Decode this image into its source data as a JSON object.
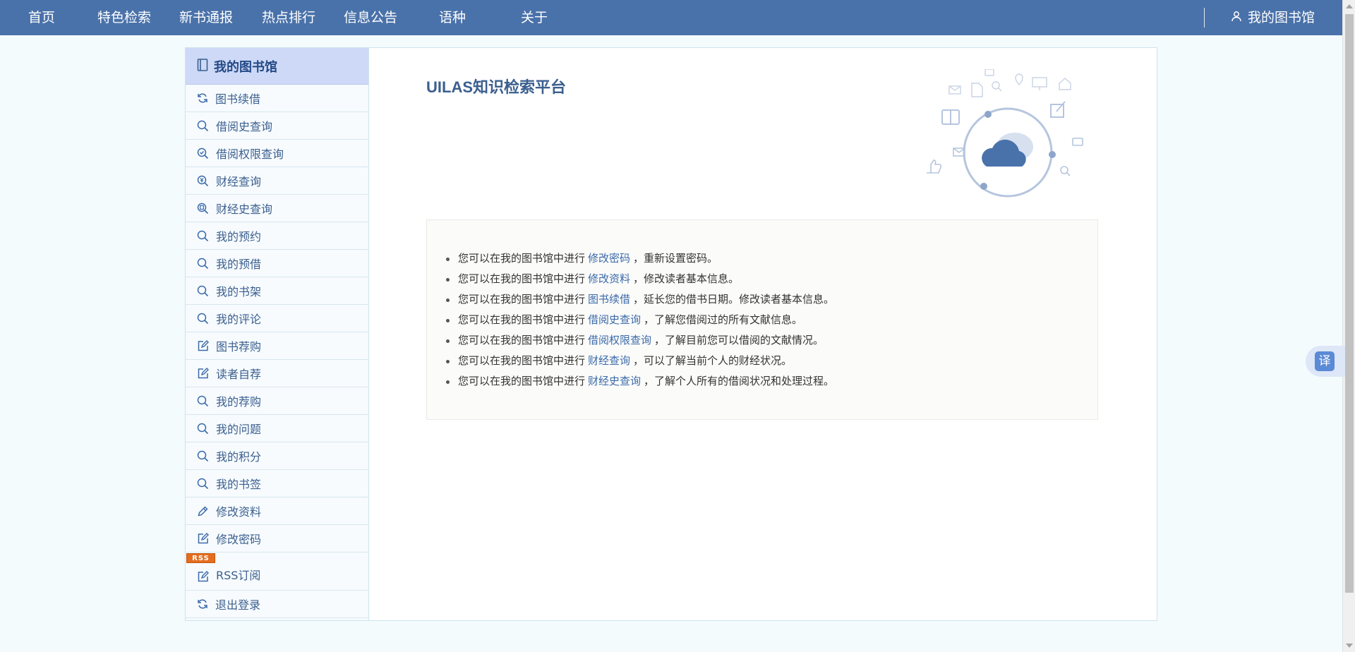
{
  "nav": {
    "items": [
      {
        "label": "首页"
      },
      {
        "label": "特色检索"
      },
      {
        "label": "新书通报"
      },
      {
        "label": "热点排行"
      },
      {
        "label": "信息公告"
      },
      {
        "label": "语种"
      },
      {
        "label": "关于"
      }
    ],
    "account_label": "我的图书馆",
    "account_icon": "user-icon"
  },
  "sidebar": {
    "title": "我的图书馆",
    "title_icon": "book-icon",
    "items": [
      {
        "label": "图书续借",
        "icon": "refresh-icon"
      },
      {
        "label": "借阅史查询",
        "icon": "search-icon"
      },
      {
        "label": "借阅权限查询",
        "icon": "check-search-icon"
      },
      {
        "label": "财经查询",
        "icon": "money-search-icon"
      },
      {
        "label": "财经史查询",
        "icon": "history-search-icon"
      },
      {
        "label": "我的预约",
        "icon": "search-icon"
      },
      {
        "label": "我的预借",
        "icon": "search-icon"
      },
      {
        "label": "我的书架",
        "icon": "search-icon"
      },
      {
        "label": "我的评论",
        "icon": "search-icon"
      },
      {
        "label": "图书荐购",
        "icon": "edit-icon"
      },
      {
        "label": "读者自荐",
        "icon": "edit-icon"
      },
      {
        "label": "我的荐购",
        "icon": "search-icon"
      },
      {
        "label": "我的问题",
        "icon": "search-icon"
      },
      {
        "label": "我的积分",
        "icon": "search-icon"
      },
      {
        "label": "我的书签",
        "icon": "search-icon"
      },
      {
        "label": "修改资料",
        "icon": "pencil-icon"
      },
      {
        "label": "修改密码",
        "icon": "edit-icon"
      },
      {
        "label": "RSS订阅",
        "icon": "edit-icon",
        "badge": "RSS"
      },
      {
        "label": "退出登录",
        "icon": "refresh-icon"
      }
    ]
  },
  "content": {
    "title": "UILAS知识检索平台",
    "illustration_icon": "cloud-icon",
    "info": [
      {
        "prefix": "您可以在我的图书馆中进行",
        "link": "修改密码",
        "suffix": "，重新设置密码。"
      },
      {
        "prefix": "您可以在我的图书馆中进行",
        "link": "修改资料",
        "suffix": "，修改读者基本信息。"
      },
      {
        "prefix": "您可以在我的图书馆中进行",
        "link": "图书续借",
        "suffix": "，延长您的借书日期。修改读者基本信息。"
      },
      {
        "prefix": "您可以在我的图书馆中进行",
        "link": "借阅史查询",
        "suffix": "，了解您借阅过的所有文献信息。"
      },
      {
        "prefix": "您可以在我的图书馆中进行",
        "link": "借阅权限查询",
        "suffix": "，了解目前您可以借阅的文献情况。"
      },
      {
        "prefix": "您可以在我的图书馆中进行",
        "link": "财经查询",
        "suffix": "，可以了解当前个人的财经状况。"
      },
      {
        "prefix": "您可以在我的图书馆中进行",
        "link": "财经史查询",
        "suffix": "，了解个人所有的借阅状况和处理过程。"
      }
    ]
  },
  "translate_button": {
    "label": "译"
  },
  "colors": {
    "nav_bg": "#4a72aa",
    "sidebar_header_bg": "#cdd9f7",
    "link": "#3b6aa8",
    "page_bg": "#f3fbfd"
  }
}
